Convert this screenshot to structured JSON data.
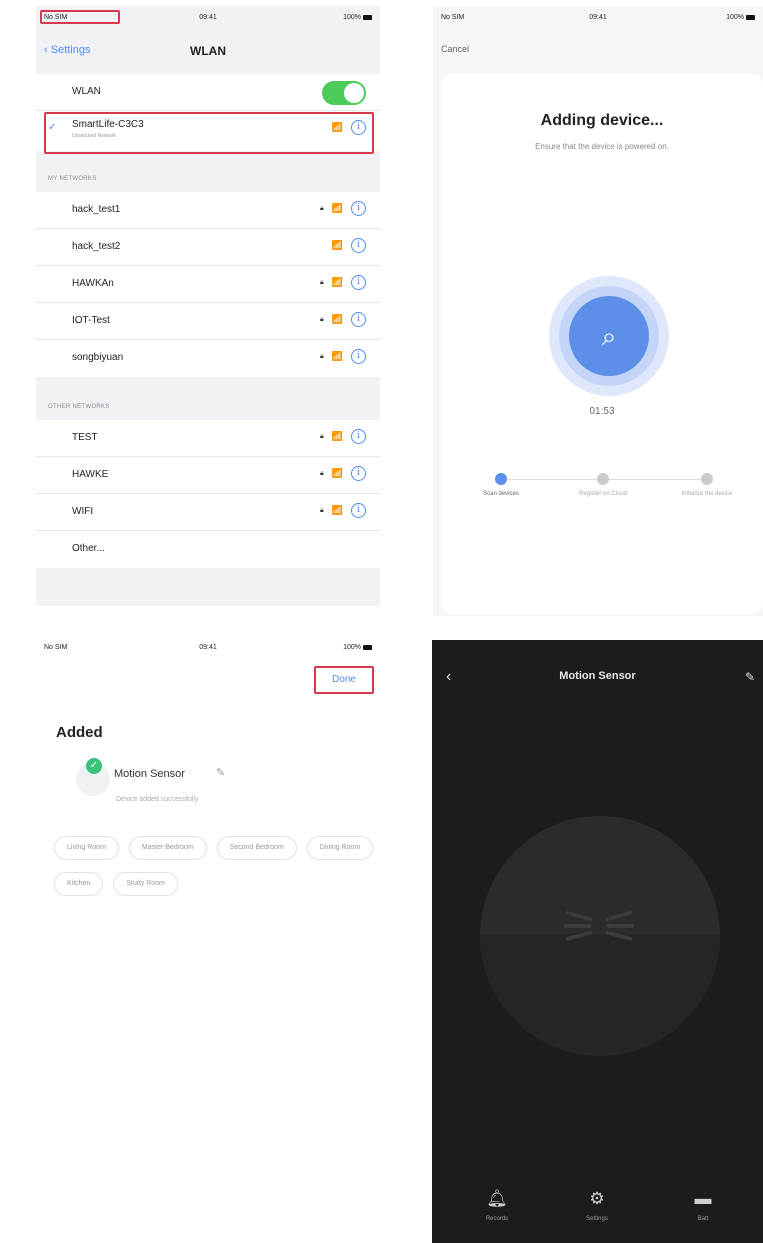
{
  "wlan_screen": {
    "status_left": "No SIM",
    "status_time": "09:41",
    "status_right": "100%",
    "back_label": "Settings",
    "title": "WLAN",
    "wlan_toggle_label": "WLAN",
    "wlan_enabled": true,
    "connected_network": {
      "name": "SmartLife-C3C3",
      "sub": "Unsecured Network"
    },
    "my_networks_label": "MY NETWORKS",
    "my_networks": [
      {
        "name": "hack_test1",
        "locked": true
      },
      {
        "name": "hack_test2",
        "locked": false
      },
      {
        "name": "HAWKAn",
        "locked": true
      },
      {
        "name": "IOT-Test",
        "locked": true
      },
      {
        "name": "songbiyuan",
        "locked": true
      }
    ],
    "other_networks_label": "OTHER NETWORKS",
    "other_networks": [
      {
        "name": "TEST",
        "locked": true
      },
      {
        "name": "HAWKE",
        "locked": true
      },
      {
        "name": "WIFI",
        "locked": true
      }
    ],
    "other_label": "Other..."
  },
  "adding_screen": {
    "status_left": "No SIM",
    "status_time": "09:41",
    "status_right": "100%",
    "cancel_label": "Cancel",
    "title": "Adding device...",
    "subtitle": "Ensure that the device is powered on.",
    "timer": "01:53",
    "steps": [
      {
        "label": "Scan devices",
        "active": true
      },
      {
        "label": "Register on Cloud",
        "active": false
      },
      {
        "label": "Initialize the device",
        "active": false
      }
    ]
  },
  "added_screen": {
    "status_left": "No SIM",
    "status_time": "09:41",
    "status_right": "100%",
    "done_label": "Done",
    "added_label": "Added",
    "device_name": "Motion Sensor",
    "device_status": "Device added successfully",
    "rooms": [
      "Living Room",
      "Master Bedroom",
      "Second Bedroom",
      "Dining Room",
      "Kitchen",
      "Study Room"
    ]
  },
  "sensor_screen": {
    "title": "Motion Sensor",
    "tabs": [
      {
        "icon": "bell-icon",
        "label": "Records"
      },
      {
        "icon": "settings-icon",
        "label": "Settings"
      },
      {
        "icon": "battery-icon",
        "label": "Batt"
      }
    ]
  },
  "accent_colors": {
    "ios_blue": "#4d8cf5",
    "toggle_green": "#4ccb5b",
    "highlight_red": "#d8394f",
    "progress_blue": "#5d8ee8"
  }
}
